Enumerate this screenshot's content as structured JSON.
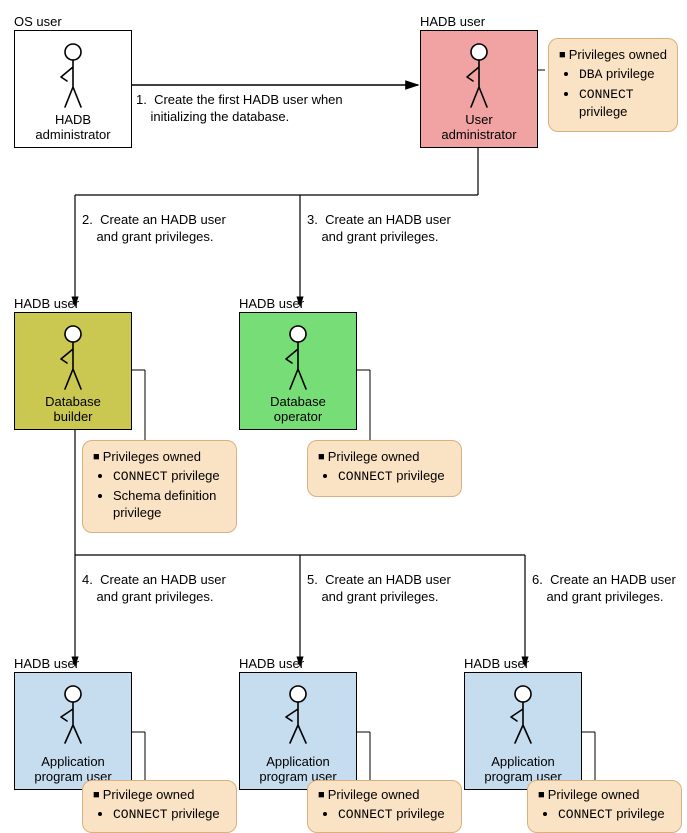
{
  "labels": {
    "os_user": "OS user",
    "hadb_user": "HADB user"
  },
  "roles": {
    "hadb_admin": "HADB\nadministrator",
    "user_admin": "User\nadministrator",
    "db_builder": "Database\nbuilder",
    "db_operator": "Database\noperator",
    "app_user": "Application\nprogram user"
  },
  "steps": {
    "s1": "1.  Create the first HADB user when\n    initializing the database.",
    "s2": "2.  Create an HADB user\n    and grant privileges.",
    "s3": "3.  Create an HADB user\n    and grant privileges.",
    "s4": "4.  Create an HADB user\n    and grant privileges.",
    "s5": "5.  Create an HADB user\n    and grant privileges.",
    "s6": "6.  Create an HADB user\n    and grant privileges."
  },
  "priv": {
    "owned_plural": "Privileges owned",
    "owned_singular": "Privilege owned",
    "dba": "DBA",
    "dba_suffix": " privilege",
    "connect": "CONNECT",
    "connect_suffix": " privilege",
    "connect_suffix_br": "\nprivilege",
    "schema": "Schema definition\nprivilege"
  },
  "colors": {
    "white": "#ffffff",
    "pink": "#f1a3a3",
    "olive": "#cac850",
    "green": "#77de77",
    "blue": "#c6ddf0",
    "priv_bg": "#fae2c4"
  }
}
